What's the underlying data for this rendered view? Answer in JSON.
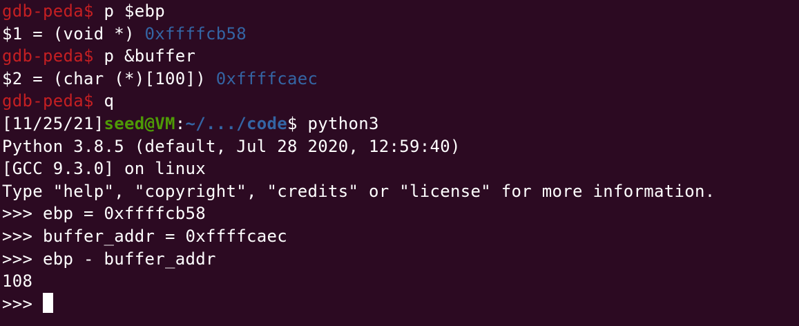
{
  "colors": {
    "background": "#2c0a22",
    "text": "#ffffff",
    "gdb_prompt": "#c51f22",
    "hex_value": "#3465a4",
    "user_host": "#4e9a06",
    "path": "#3465a4"
  },
  "gdb": {
    "prompt": "gdb-peda$",
    "cmd1": " p $ebp",
    "result1_prefix": "$1 = (void *) ",
    "result1_value": "0xffffcb58",
    "cmd2": " p &buffer",
    "result2_prefix": "$2 = (char (*)[100]) ",
    "result2_value": "0xffffcaec",
    "cmd3": " q"
  },
  "shell": {
    "date": "[11/25/21]",
    "user_host": "seed@VM",
    "colon": ":",
    "path": "~/.../code",
    "dollar": "$",
    "command": " python3"
  },
  "python": {
    "banner1": "Python 3.8.5 (default, Jul 28 2020, 12:59:40)",
    "banner2": "[GCC 9.3.0] on linux",
    "banner3": "Type \"help\", \"copyright\", \"credits\" or \"license\" for more information.",
    "in1": ">>> ebp = 0xffffcb58",
    "in2": ">>> buffer_addr = 0xffffcaec",
    "in3": ">>> ebp - buffer_addr",
    "out3": "108",
    "prompt": ">>> "
  }
}
